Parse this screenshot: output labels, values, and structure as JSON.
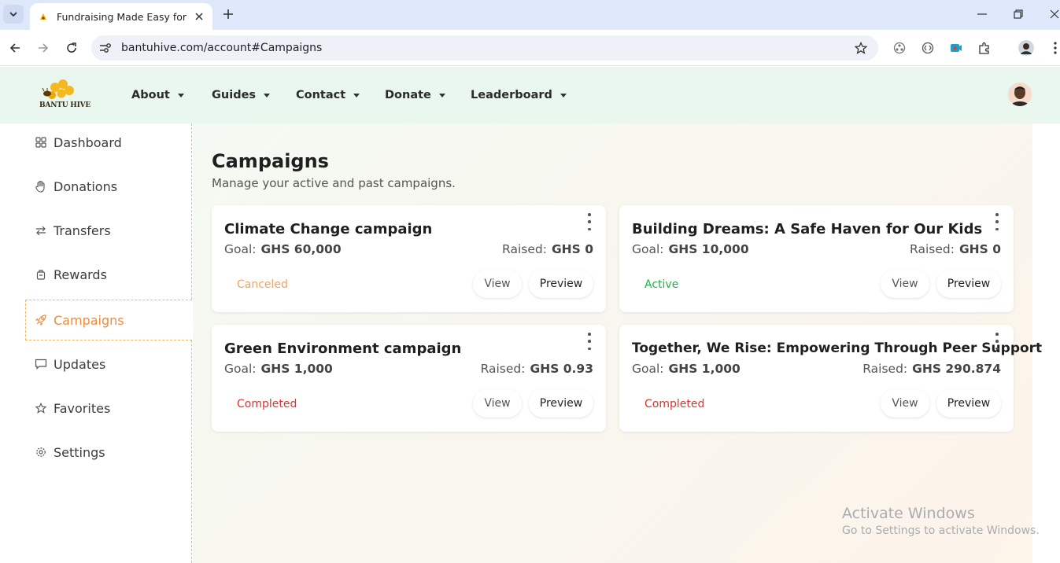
{
  "browser": {
    "tab_title": "Fundraising Made Easy for Afric",
    "url": "bantuhive.com/account#Campaigns"
  },
  "header": {
    "logo_text": "BANTU HIVE",
    "menu": [
      {
        "label": "About"
      },
      {
        "label": "Guides"
      },
      {
        "label": "Contact"
      },
      {
        "label": "Donate"
      },
      {
        "label": "Leaderboard"
      }
    ]
  },
  "sidebar": {
    "items": [
      {
        "label": "Dashboard",
        "icon": "grid-icon"
      },
      {
        "label": "Donations",
        "icon": "hand-icon"
      },
      {
        "label": "Transfers",
        "icon": "arrows-icon"
      },
      {
        "label": "Rewards",
        "icon": "gift-icon"
      },
      {
        "label": "Campaigns",
        "icon": "rocket-icon",
        "active": true
      },
      {
        "label": "Updates",
        "icon": "chat-icon"
      },
      {
        "label": "Favorites",
        "icon": "star-icon"
      },
      {
        "label": "Settings",
        "icon": "gear-icon"
      }
    ]
  },
  "main": {
    "title": "Campaigns",
    "subtitle": "Manage your active and past campaigns.",
    "goal_label": "Goal:",
    "raised_label": "Raised:",
    "view_label": "View",
    "preview_label": "Preview",
    "campaigns": [
      {
        "title": "Climate Change campaign",
        "goal": "GHS 60,000",
        "raised": "GHS 0",
        "status": "Canceled",
        "status_color": "#f5a25d"
      },
      {
        "title": "Building Dreams: A Safe Haven for Our Kids",
        "goal": "GHS 10,000",
        "raised": "GHS 0",
        "status": "Active",
        "status_color": "#22b14c"
      },
      {
        "title": "Green Environment campaign",
        "goal": "GHS 1,000",
        "raised": "GHS 0.93",
        "status": "Completed",
        "status_color": "#e03131"
      },
      {
        "title": "Together, We Rise: Empowering Through Peer Support",
        "goal": "GHS 1,000",
        "raised": "GHS 290.874",
        "status": "Completed",
        "status_color": "#e03131"
      }
    ]
  },
  "watermark": {
    "line1": "Activate Windows",
    "line2": "Go to Settings to activate Windows."
  },
  "colors": {
    "accent": "#f5a25d",
    "header_bg": "#e9f7ee"
  }
}
